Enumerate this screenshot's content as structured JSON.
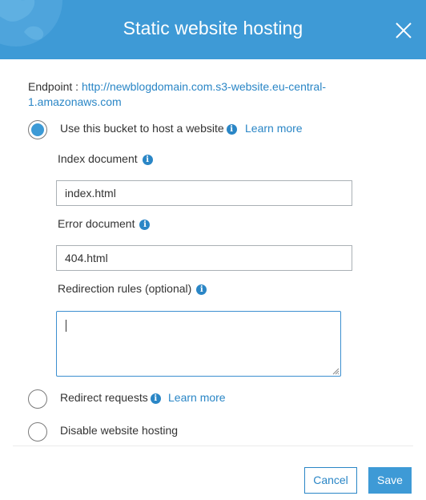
{
  "header": {
    "title": "Static website hosting"
  },
  "endpoint": {
    "label": "Endpoint : ",
    "url_line1": "http://newblogdomain.com.s3-website.eu-central-",
    "url_line2": "1.amazonaws.com"
  },
  "options": {
    "host": {
      "label": "Use this bucket to host a website",
      "learn_more": "Learn more",
      "selected": true
    },
    "redirect": {
      "label": "Redirect requests",
      "learn_more": "Learn more",
      "selected": false
    },
    "disable": {
      "label": "Disable website hosting",
      "selected": false
    }
  },
  "fields": {
    "index_document": {
      "label": "Index document",
      "value": "index.html"
    },
    "error_document": {
      "label": "Error document",
      "value": "404.html"
    },
    "redirection_rules": {
      "label": "Redirection rules (optional)",
      "value": ""
    }
  },
  "footer": {
    "cancel_label": "Cancel",
    "save_label": "Save"
  },
  "icons": {
    "info": "info-icon",
    "close": "close-icon"
  },
  "colors": {
    "header_bg": "#3e9ad6",
    "link": "#2a86c6",
    "primary_button": "#3e9ad6"
  }
}
